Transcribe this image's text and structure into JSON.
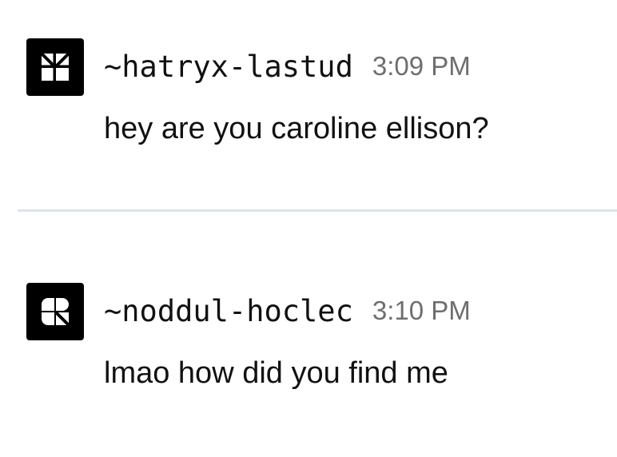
{
  "messages": [
    {
      "author": "~hatryx-lastud",
      "time": "3:09 PM",
      "text": "hey are you caroline ellison?",
      "avatar_icon": "sigil-avatar-icon"
    },
    {
      "author": "~noddul-hoclec",
      "time": "3:10 PM",
      "text": "lmao how did you find me",
      "avatar_icon": "sigil-avatar-icon"
    }
  ],
  "colors": {
    "text": "#111111",
    "timestamp": "#6e6e6e",
    "divider": "#d7e6f2",
    "avatar_bg": "#000000"
  }
}
